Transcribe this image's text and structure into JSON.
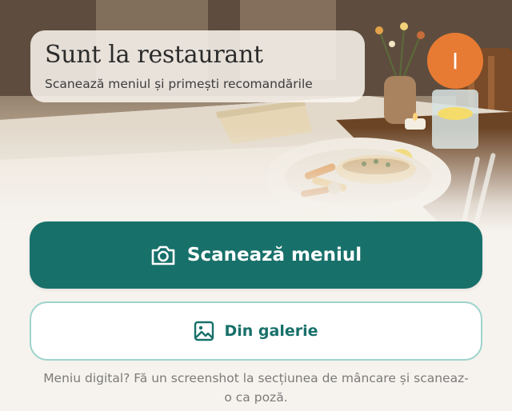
{
  "header": {
    "title": "Sunt la restaurant",
    "subtitle": "Scanează meniul și primești recomandările",
    "avatar_initial": "I"
  },
  "actions": {
    "scan_label": "Scanează meniul",
    "scan_icon": "camera-icon",
    "gallery_label": "Din galerie",
    "gallery_icon": "image-icon"
  },
  "hint": {
    "text": "Meniu digital? Fă un screenshot la secțiunea de mâncare și scaneaz-o ca poză."
  },
  "colors": {
    "primary": "#18706a",
    "secondary_border": "#9ed3cd",
    "avatar": "#e87b34",
    "background": "#f6f3ee"
  }
}
